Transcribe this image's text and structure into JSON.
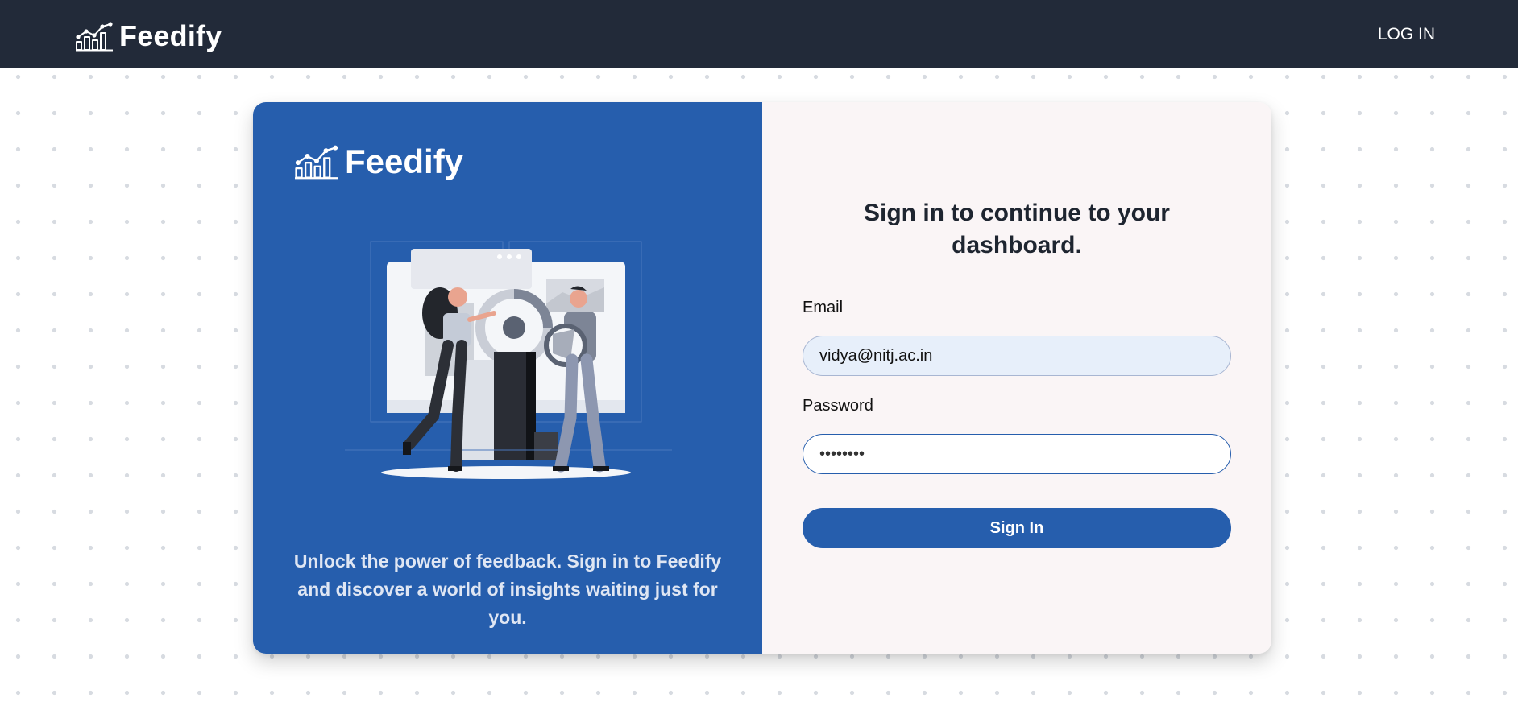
{
  "brand": {
    "name": "Feedify",
    "logo_icon": "bar-chart-trend-icon"
  },
  "nav": {
    "login_label": "LOG IN"
  },
  "panel": {
    "tagline": "Unlock the power of feedback. Sign in to Feedify and discover a world of insights waiting just for you.",
    "illustration": "people-analyzing-dashboard-illustration"
  },
  "form": {
    "heading": "Sign in to continue to your dashboard.",
    "email_label": "Email",
    "email_value": "vidya@nitj.ac.in",
    "password_label": "Password",
    "password_value": "••••••••",
    "submit_label": "Sign In"
  },
  "colors": {
    "topbar": "#222a39",
    "accent": "#265ead",
    "form_panel": "#faf5f6",
    "email_field_bg": "#e7effa"
  }
}
